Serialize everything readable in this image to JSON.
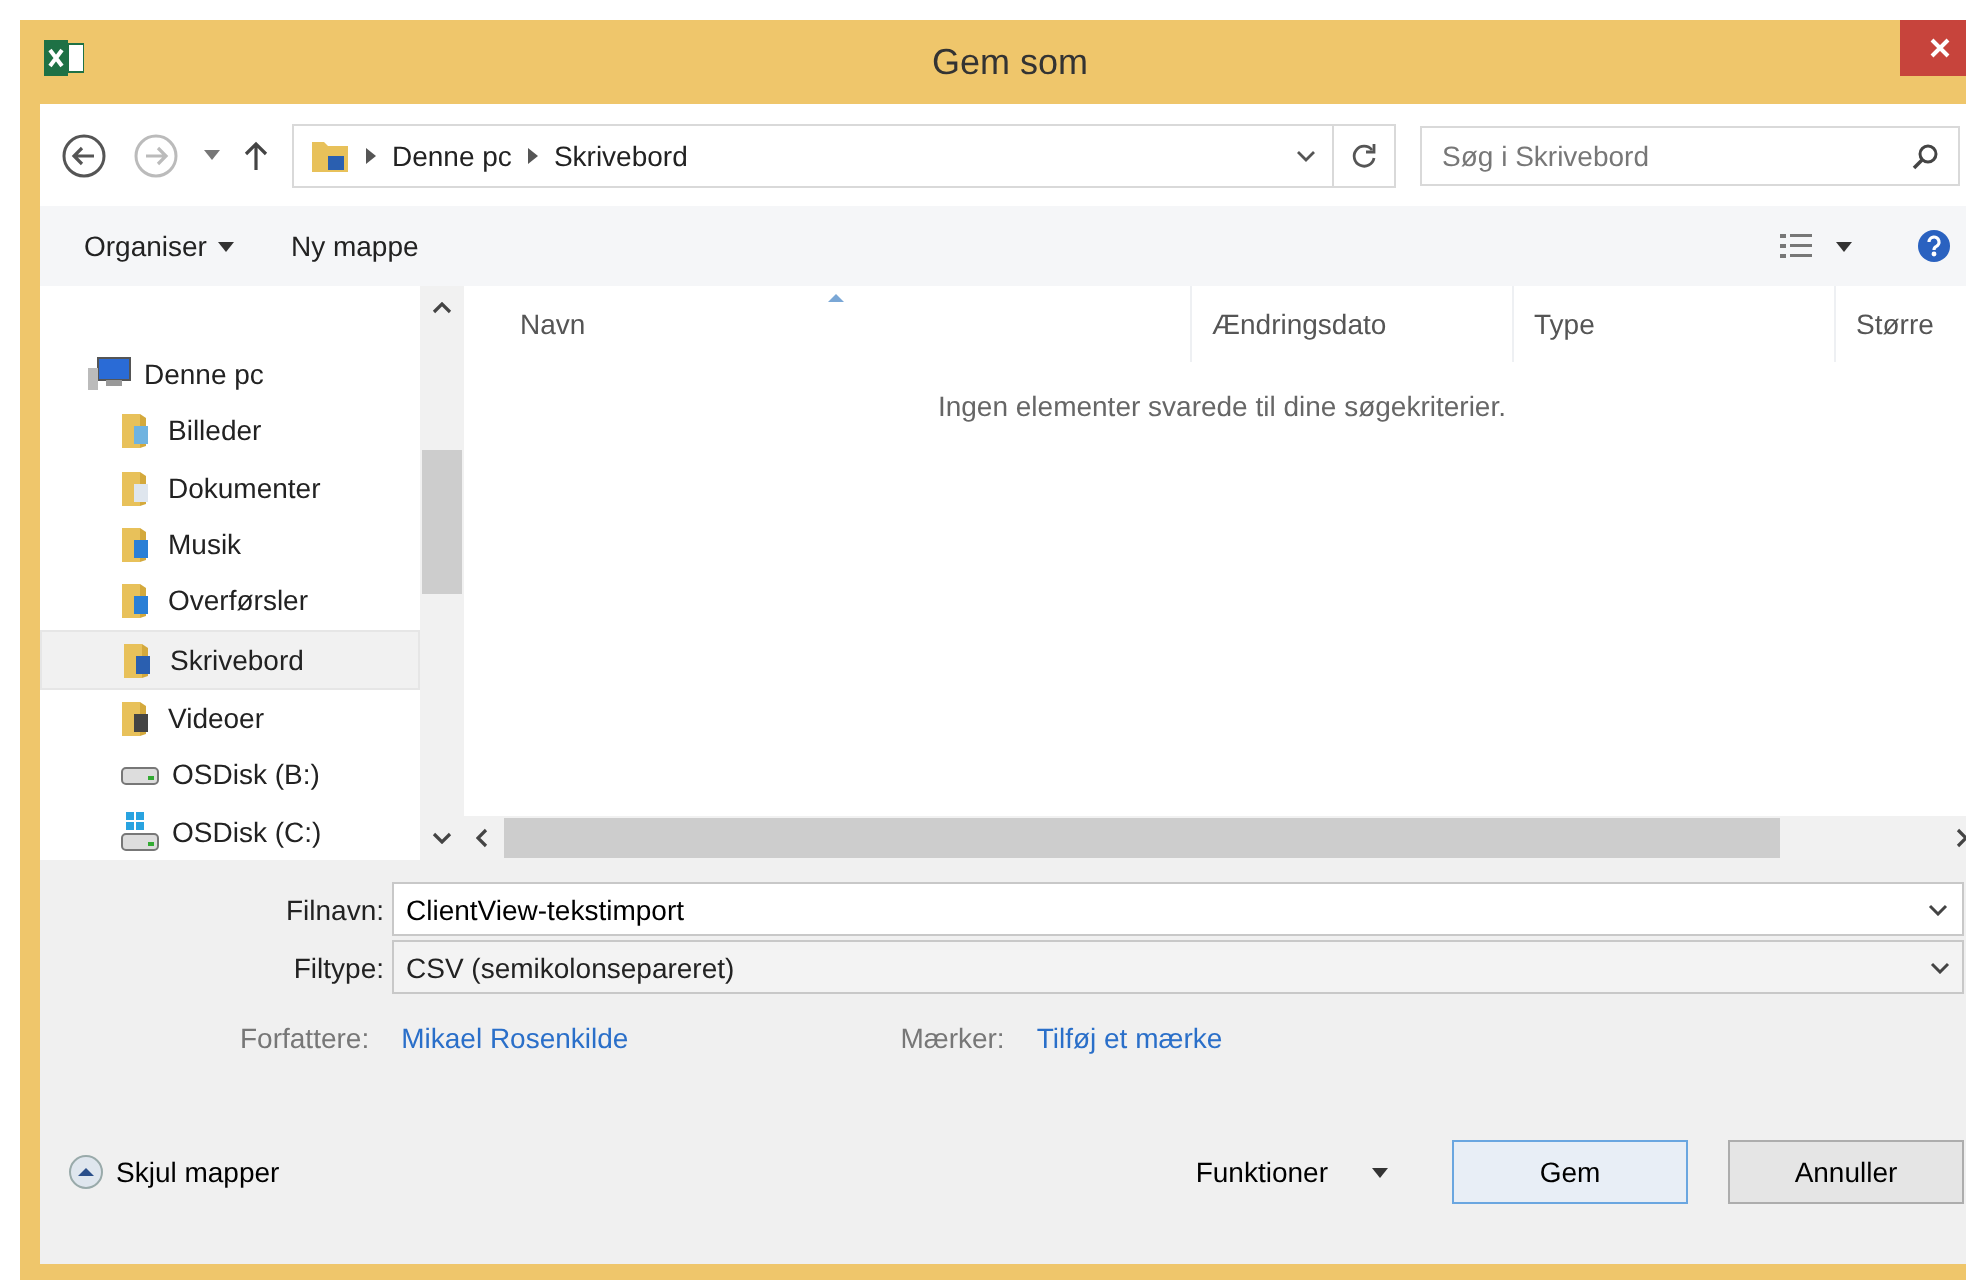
{
  "window": {
    "title": "Gem som"
  },
  "breadcrumb": [
    "Denne pc",
    "Skrivebord"
  ],
  "search": {
    "placeholder": "Søg i Skrivebord"
  },
  "toolbar": [
    "Organiser",
    "Ny mappe"
  ],
  "sidebar": {
    "items": [
      {
        "label": "Denne pc",
        "kind": "computer",
        "selected": false,
        "children": [
          {
            "label": "Billeder",
            "kind": "pictures",
            "selected": false
          },
          {
            "label": "Dokumenter",
            "kind": "documents",
            "selected": false
          },
          {
            "label": "Musik",
            "kind": "music",
            "selected": false
          },
          {
            "label": "Overførsler",
            "kind": "downloads",
            "selected": false
          },
          {
            "label": "Skrivebord",
            "kind": "desktop",
            "selected": true
          },
          {
            "label": "Videoer",
            "kind": "videos",
            "selected": false
          },
          {
            "label": "OSDisk (B:)",
            "kind": "drive",
            "selected": false
          },
          {
            "label": "OSDisk (C:)",
            "kind": "system-drive",
            "selected": false
          }
        ]
      }
    ]
  },
  "table": {
    "columns": [
      {
        "label": "Navn",
        "sorted": true
      },
      {
        "label": "Ændringsdato",
        "sorted": false
      },
      {
        "label": "Type",
        "sorted": false
      },
      {
        "label": "Større",
        "sorted": false
      }
    ],
    "empty_message": "Ingen elementer svarede til dine søgekriterier."
  },
  "fields": [
    {
      "label": "Filnavn:",
      "value": "ClientView-tekstimport",
      "kind": "combo"
    },
    {
      "label": "Filtype:",
      "value": "CSV (semikolonsepareret)",
      "kind": "select"
    }
  ],
  "meta": [
    {
      "label": "Forfattere:",
      "value": "Mikael Rosenkilde"
    },
    {
      "label": "Mærker:",
      "value": "Tilføj et mærke"
    }
  ],
  "hide_folders": "Skjul mapper",
  "buttons": [
    {
      "label": "Funktioner",
      "kind": "menu"
    },
    {
      "label": "Gem",
      "kind": "push",
      "default": true
    },
    {
      "label": "Annuller",
      "kind": "push",
      "default": false
    }
  ]
}
